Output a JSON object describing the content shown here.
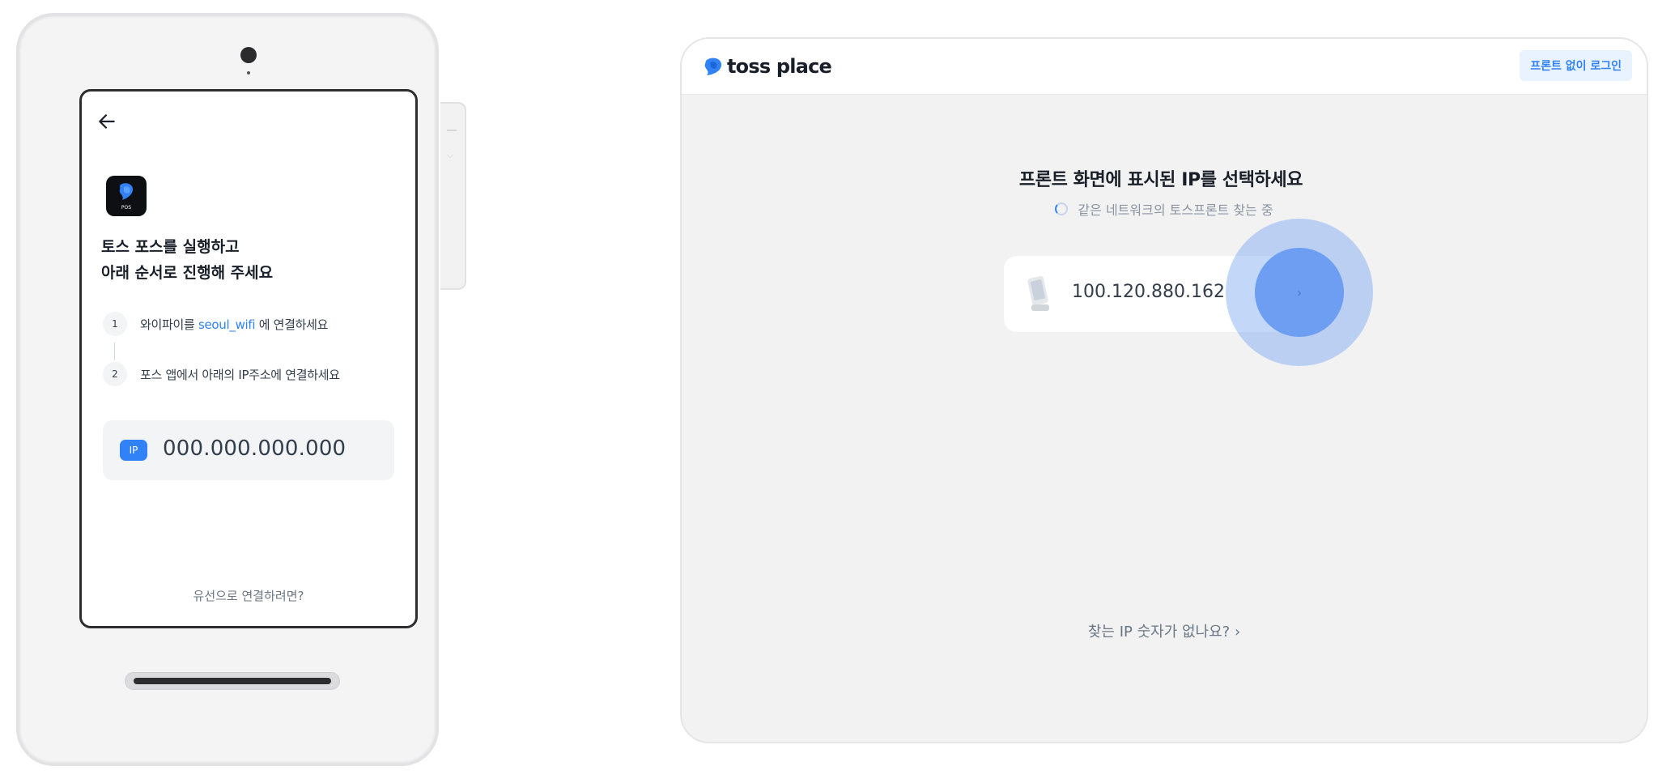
{
  "device": {
    "app_icon_label": "POS",
    "heading_line1": "토스 포스를 실행하고",
    "heading_line2": "아래 순서로 진행해 주세요",
    "steps": [
      {
        "num": "1",
        "text_before": "와이파이를 ",
        "highlight": "seoul_wifi",
        "text_after": " 에 연결하세요"
      },
      {
        "num": "2",
        "text_before": "포스 앱에서 아래의 IP주소에 연결하세요",
        "highlight": "",
        "text_after": ""
      }
    ],
    "ip_badge": "IP",
    "ip_value": "000.000.000.000",
    "wired_link": "유선으로 연결하려면?"
  },
  "window": {
    "logo_text": "toss place",
    "login_button": "프론트 없이 로그인",
    "title": "프론트 화면에 표시된 IP를 선택하세요",
    "searching_text": "같은 네트워크의 토스프론트 찾는 중",
    "ip_card_value": "100.120.880.162",
    "go_arrow": "›",
    "no_ip_link": "찾는 IP 숫자가 없나요? ›"
  },
  "colors": {
    "accent": "#3182f6",
    "window_bg": "#f2f2f3",
    "pulse": "#6d9ef2"
  },
  "icons": [
    "back-arrow-icon",
    "toss-pos-app-icon",
    "toss-logo-icon",
    "spinner-icon",
    "pos-terminal-icon",
    "chevron-right-icon"
  ]
}
